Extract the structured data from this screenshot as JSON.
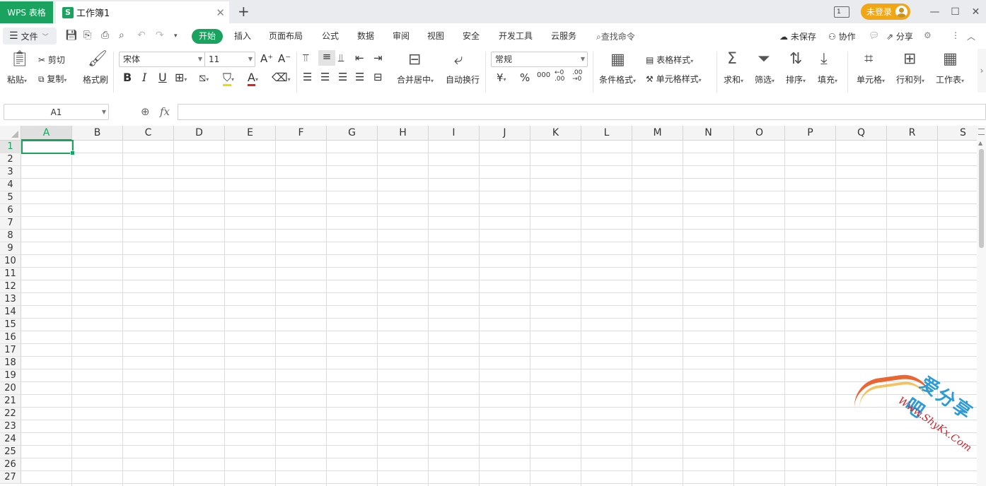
{
  "title_bar": {
    "app_tab": "WPS 表格",
    "doc_tab": "工作簿1",
    "doc_icon": "S",
    "close_glyph": "✕",
    "new_tab_glyph": "+",
    "layout_count": "1",
    "login_label": "未登录"
  },
  "menu": {
    "file_label": "文件",
    "tabs": [
      "开始",
      "插入",
      "页面布局",
      "公式",
      "数据",
      "审阅",
      "视图",
      "安全",
      "开发工具",
      "云服务"
    ],
    "search_label": "查找命令",
    "unsaved_label": "未保存",
    "collab_label": "协作",
    "share_label": "分享"
  },
  "ribbon": {
    "paste": "粘贴",
    "cut": "剪切",
    "copy": "复制",
    "format_painter": "格式刷",
    "font_name": "宋体",
    "font_size": "11",
    "merge_center": "合并居中",
    "wrap_text": "自动换行",
    "number_format": "常规",
    "currency": "¥",
    "percent": "%",
    "thousands": "000",
    "cond_format": "条件格式",
    "table_style": "表格样式",
    "cell_style": "单元格样式",
    "sum": "求和",
    "filter": "筛选",
    "sort": "排序",
    "fill": "填充",
    "cell": "单元格",
    "row_col": "行和列",
    "worksheet": "工作表"
  },
  "formula_bar": {
    "name_box": "A1",
    "fx": "fx",
    "formula": ""
  },
  "grid": {
    "columns": [
      "A",
      "B",
      "C",
      "D",
      "E",
      "F",
      "G",
      "H",
      "I",
      "J",
      "K",
      "L",
      "M",
      "N",
      "O",
      "P",
      "Q",
      "R",
      "S"
    ],
    "rows": [
      "1",
      "2",
      "3",
      "4",
      "5",
      "6",
      "7",
      "8",
      "9",
      "10",
      "11",
      "12",
      "13",
      "14",
      "15",
      "16",
      "17",
      "18",
      "19",
      "20",
      "21",
      "22",
      "23",
      "24",
      "25",
      "26",
      "27"
    ],
    "selected_cell": "A1"
  },
  "watermark": {
    "text_cn": "爱分享吧",
    "text_url": "Www.ShyKx.Com"
  },
  "colors": {
    "accent": "#1aa25f",
    "login": "#f2a614"
  }
}
